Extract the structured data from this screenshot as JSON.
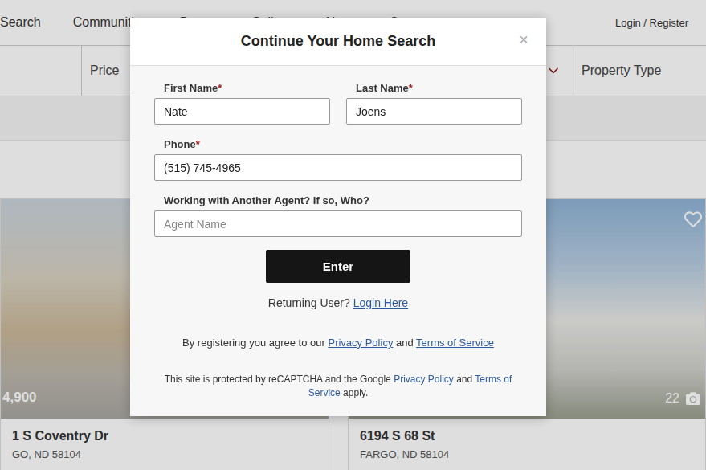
{
  "nav": {
    "items": [
      {
        "label": "Search"
      },
      {
        "label": "Communities"
      },
      {
        "label": "Buyers"
      },
      {
        "label": "Sellers"
      },
      {
        "label": "About"
      },
      {
        "label": "Contact"
      }
    ],
    "account": "Login / Register"
  },
  "filters": {
    "price": "Price",
    "property_type": "Property Type"
  },
  "listings": [
    {
      "price": "4,900",
      "address": "1 S Coventry Dr",
      "city": "GO, ND 58104"
    },
    {
      "photo_count": "22",
      "favorited": false,
      "address": "6194 S 68 St",
      "city": "FARGO, ND 58104"
    }
  ],
  "modal": {
    "title": "Continue Your Home Search",
    "close": "×",
    "required_mark": "*",
    "rows": [
      [
        {
          "label": "First Name",
          "required": true,
          "value": "Nate",
          "placeholder": ""
        },
        {
          "label": "Last Name",
          "required": true,
          "value": "Joens",
          "placeholder": ""
        }
      ],
      [
        {
          "label": "Phone",
          "required": true,
          "value": "(515) 745-4965",
          "placeholder": ""
        }
      ],
      [
        {
          "label": "Working with Another Agent? If so, Who?",
          "required": false,
          "value": "",
          "placeholder": "Agent Name"
        }
      ]
    ],
    "submit": "Enter",
    "returning": {
      "text": "Returning User?",
      "link": "Login Here"
    },
    "terms": {
      "prefix": "By registering you agree to our",
      "privacy": "Privacy Policy",
      "and": "and",
      "tos": "Terms of Service"
    },
    "recaptcha": {
      "prefix": "This site is protected by reCAPTCHA and the Google",
      "privacy": "Privacy Policy",
      "and": "and",
      "tos": "Terms of Service",
      "suffix": "apply."
    }
  }
}
